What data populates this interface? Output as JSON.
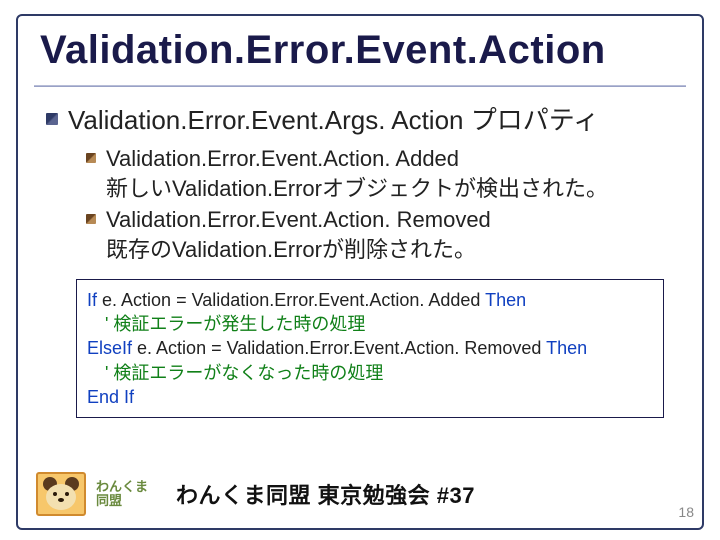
{
  "title": "Validation.Error.Event.Action",
  "level1": {
    "item1": "Validation.Error.Event.Args. Action プロパティ"
  },
  "level2": {
    "item1a": "Validation.Error.Event.Action. Added",
    "item1b": "新しいValidation.Errorオブジェクトが検出された。",
    "item2a": "Validation.Error.Event.Action. Removed",
    "item2b": "既存のValidation.Errorが削除された。"
  },
  "code": {
    "l1_kw1": "If",
    "l1_txt": " e. Action = Validation.Error.Event.Action. Added ",
    "l1_kw2": "Then",
    "l2_cm": "　' 検証エラーが発生した時の処理",
    "l3_kw1": "ElseIf",
    "l3_txt": " e. Action = Validation.Error.Event.Action. Removed ",
    "l3_kw2": "Then",
    "l4_cm": "　' 検証エラーがなくなった時の処理",
    "l5_kw": "End If"
  },
  "footer": {
    "logo_line1": "わんくま",
    "logo_line2": "同盟",
    "title": "わんくま同盟 東京勉強会 #37"
  },
  "page_number": "18"
}
